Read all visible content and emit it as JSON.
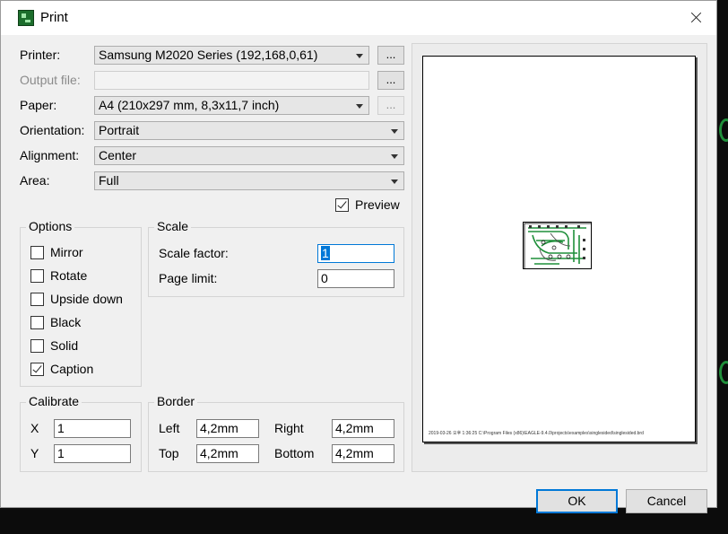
{
  "window": {
    "title": "Print",
    "close_icon": "close-icon"
  },
  "printer": {
    "label": "Printer:",
    "value": "Samsung M2020 Series (192,168,0,61)",
    "browse_label": "..."
  },
  "output_file": {
    "label": "Output file:",
    "value": "",
    "browse_label": "..."
  },
  "paper": {
    "label": "Paper:",
    "value": "A4 (210x297 mm, 8,3x11,7 inch)",
    "browse_label": "..."
  },
  "orientation": {
    "label": "Orientation:",
    "value": "Portrait"
  },
  "alignment": {
    "label": "Alignment:",
    "value": "Center"
  },
  "area": {
    "label": "Area:",
    "value": "Full"
  },
  "preview": {
    "label": "Preview",
    "checked": true
  },
  "options": {
    "title": "Options",
    "items": [
      {
        "label": "Mirror",
        "checked": false
      },
      {
        "label": "Rotate",
        "checked": false
      },
      {
        "label": "Upside down",
        "checked": false
      },
      {
        "label": "Black",
        "checked": false
      },
      {
        "label": "Solid",
        "checked": false
      },
      {
        "label": "Caption",
        "checked": true
      }
    ]
  },
  "scale": {
    "title": "Scale",
    "scale_factor_label": "Scale factor:",
    "scale_factor_value": "1",
    "page_limit_label": "Page limit:",
    "page_limit_value": "0"
  },
  "calibrate": {
    "title": "Calibrate",
    "x_label": "X",
    "x_value": "1",
    "y_label": "Y",
    "y_value": "1"
  },
  "border": {
    "title": "Border",
    "left_label": "Left",
    "left_value": "4,2mm",
    "right_label": "Right",
    "right_value": "4,2mm",
    "top_label": "Top",
    "top_value": "4,2mm",
    "bottom_label": "Bottom",
    "bottom_value": "4,2mm"
  },
  "preview_page": {
    "caption": "2019-03-26 오후 1:36:25 C:\\Program Files (x86)\\EAGLE-9.4.0\\projects\\examples\\singlesided\\singlesided.brd"
  },
  "buttons": {
    "ok": "OK",
    "cancel": "Cancel"
  },
  "colors": {
    "accent": "#0078d7",
    "pcb_trace": "#1f8f3a",
    "window_bg": "#f0f0f0"
  }
}
